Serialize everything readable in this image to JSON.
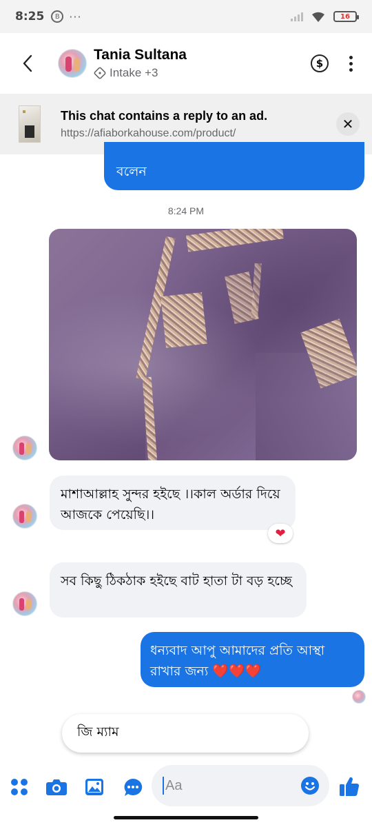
{
  "status_bar": {
    "time": "8:25",
    "notification_badge": "B",
    "more": "···",
    "battery": "16"
  },
  "header": {
    "name": "Tania Sultana",
    "subtitle": "Intake +3"
  },
  "ad_banner": {
    "title": "This chat contains a reply to an ad.",
    "url": "https://afiaborkahouse.com/product/"
  },
  "messages": {
    "prev_out_tail": "বলেন",
    "timestamp": "8:24 PM",
    "in_1": "মাশাআল্লাহ সুন্দর হইছে ।।কাল অর্ডার দিয়ে আজকে পেয়েছি।।",
    "in_1_reaction": "❤",
    "in_2": "সব কিছু ঠিকঠাক হইছে বাট হাতা টা বড় হচ্ছে",
    "out_1": "ধন্যবাদ আপু আমাদের প্রতি আস্থা রাখার জন্য ❤️❤️❤️"
  },
  "quick_reply": "জি ম্যাম",
  "composer": {
    "placeholder": "Aa"
  },
  "colors": {
    "accent": "#1b74e4",
    "incoming_bubble": "#f0f2f5",
    "reaction_heart": "#e41e3f"
  }
}
